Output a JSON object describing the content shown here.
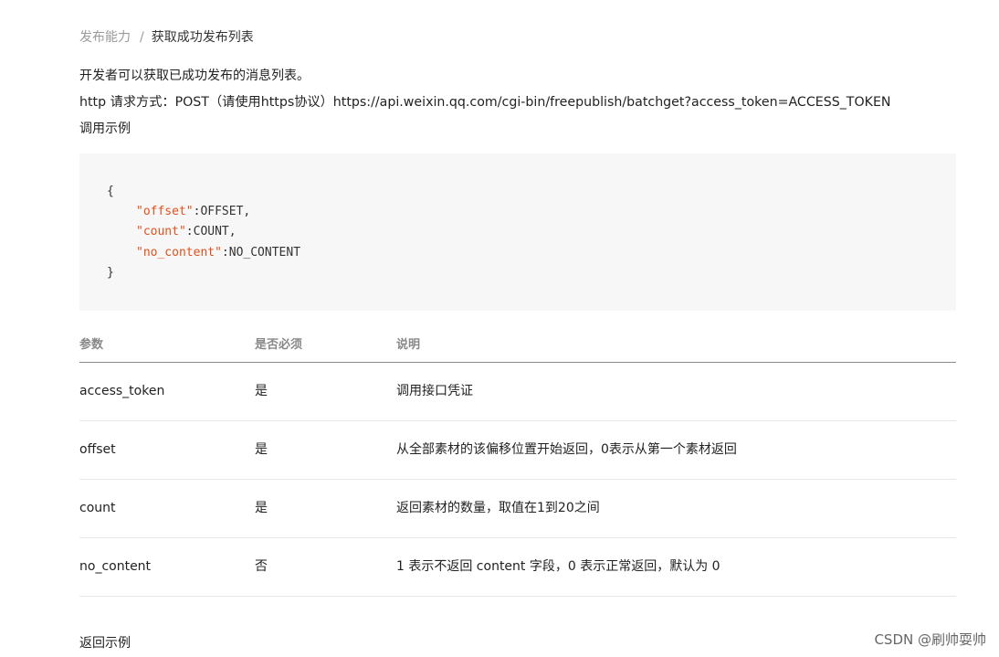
{
  "breadcrumb": {
    "parent": "发布能力",
    "separator": "/",
    "current": "获取成功发布列表"
  },
  "intro": {
    "line1": "开发者可以获取已成功发布的消息列表。",
    "line2": "http 请求方式：POST（请使用https协议）https://api.weixin.qq.com/cgi-bin/freepublish/batchget?access_token=ACCESS_TOKEN",
    "line3": "调用示例"
  },
  "code": {
    "open": "{",
    "lines": [
      {
        "key": "\"offset\"",
        "sep": ":",
        "value": "OFFSET,"
      },
      {
        "key": "\"count\"",
        "sep": ":",
        "value": "COUNT,"
      },
      {
        "key": "\"no_content\"",
        "sep": ":",
        "value": "NO_CONTENT"
      }
    ],
    "close": "}"
  },
  "table": {
    "headers": [
      "参数",
      "是否必须",
      "说明"
    ],
    "rows": [
      [
        "access_token",
        "是",
        "调用接口凭证"
      ],
      [
        "offset",
        "是",
        "从全部素材的该偏移位置开始返回，0表示从第一个素材返回"
      ],
      [
        "count",
        "是",
        "返回素材的数量，取值在1到20之间"
      ],
      [
        "no_content",
        "否",
        "1 表示不返回 content 字段，0 表示正常返回，默认为 0"
      ]
    ]
  },
  "footer": {
    "label": "返回示例"
  },
  "watermark": "CSDN @刷帅耍帅",
  "colors": {
    "code_key": "#e0511b",
    "code_bg": "#f7f7f7",
    "muted_text": "#9a9a9a"
  }
}
